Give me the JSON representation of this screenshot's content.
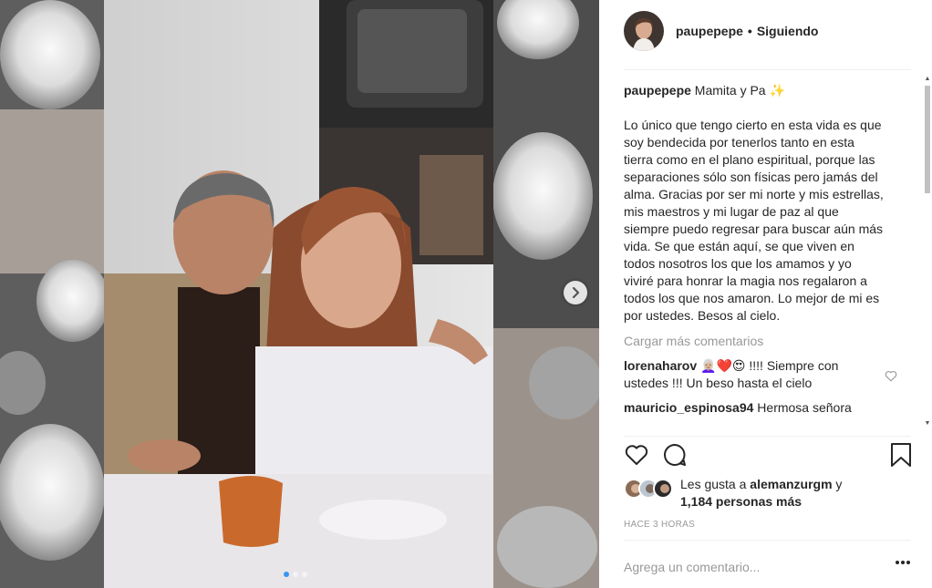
{
  "post": {
    "username": "paupepepe",
    "separator": "•",
    "follow_status": "Siguiendo"
  },
  "caption": {
    "username": "paupepepe",
    "title": "Mamita y Pa ✨",
    "body": "Lo único que tengo cierto en esta vida es que soy bendecida por tenerlos tanto en esta tierra como en el plano espiritual, porque las separaciones sólo son físicas pero jamás del alma. Gracias por ser mi norte y mis estrellas, mis maestros y mi lugar de paz al que siempre puedo regresar para buscar aún más vida. Se que están aquí, se que viven en todos nosotros los que los amamos y yo viviré para honrar la magia nos regalaron a todos los que nos amaron. Lo mejor de mi es por ustedes. Besos al cielo."
  },
  "load_more": "Cargar más comentarios",
  "comments": [
    {
      "username": "lorenaharov",
      "text": "👩🏼‍🦳❤️😍 !!!! Siempre con ustedes !!! Un beso hasta el cielo"
    },
    {
      "username": "mauricio_espinosa94",
      "text": "Hermosa señora"
    }
  ],
  "likes": {
    "prefix": "Les gusta a",
    "user": "alemanzurgm",
    "conj": "y",
    "count": "1,184 personas más"
  },
  "timestamp": "Hace 3 horas",
  "add_comment": {
    "placeholder": "Agrega un comentario..."
  },
  "carousel": {
    "total": 3,
    "active": 1
  },
  "icons": {
    "like": "heart-icon",
    "comment": "comment-bubble-icon",
    "save": "bookmark-icon",
    "next": "chevron-right-icon",
    "more": "more-options-icon"
  },
  "colors": {
    "accent": "#3897f0",
    "muted": "#999999",
    "text": "#262626"
  }
}
